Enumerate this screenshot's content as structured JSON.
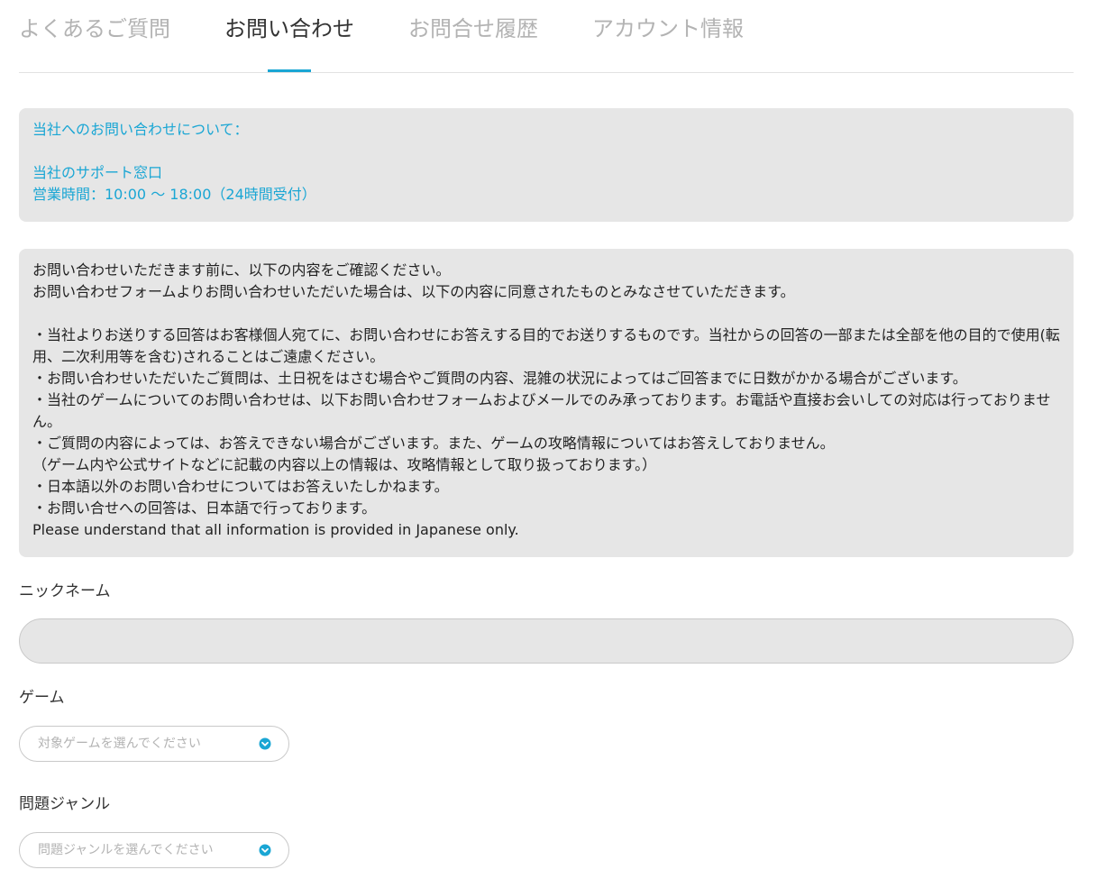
{
  "tabs": [
    {
      "label": "よくあるご質問",
      "active": false
    },
    {
      "label": "お問い合わせ",
      "active": true
    },
    {
      "label": "お問合せ履歴",
      "active": false
    },
    {
      "label": "アカウント情報",
      "active": false
    }
  ],
  "notice": {
    "lines": [
      "当社へのお問い合わせについて：",
      "",
      "当社のサポート窓口",
      "営業時間：10:00 〜 18:00（24時間受付）"
    ]
  },
  "terms": {
    "lines": [
      "お問い合わせいただきます前に、以下の内容をご確認ください。",
      "お問い合わせフォームよりお問い合わせいただいた場合は、以下の内容に同意されたものとみなさせていただきます。",
      "",
      "・当社よりお送りする回答はお客様個人宛てに、お問い合わせにお答えする目的でお送りするものです。当社からの回答の一部または全部を他の目的で使用(転",
      "用、二次利用等を含む)されることはご遠慮ください。",
      "・お問い合わせいただいたご質問は、土日祝をはさむ場合やご質問の内容、混雑の状況によってはご回答までに日数がかかる場合がございます。",
      "・当社のゲームについてのお問い合わせは、以下お問い合わせフォームおよびメールでのみ承っております。お電話や直接お会いしての対応は行っておりませ",
      "ん。",
      "・ご質問の内容によっては、お答えできない場合がございます。また、ゲームの攻略情報についてはお答えしておりません。",
      "（ゲーム内や公式サイトなどに記載の内容以上の情報は、攻略情報として取り扱っております。）",
      "・日本語以外のお問い合わせについてはお答えいたしかねます。",
      "・お問い合せへの回答は、日本語で行っております。",
      "Please understand that all information is provided in Japanese only."
    ]
  },
  "form": {
    "nickname": {
      "label": "ニックネーム",
      "value": "",
      "placeholder": ""
    },
    "game": {
      "label": "ゲーム",
      "placeholder": "対象ゲームを選んでください"
    },
    "genre": {
      "label": "問題ジャンル",
      "placeholder": "問題ジャンルを選んでください"
    }
  },
  "colors": {
    "accent": "#1aa6d4",
    "box_bg": "#e6e6e6",
    "inactive_tab": "#b3b3b3"
  },
  "icons": {
    "select_chevron": "chevron-down-circle-icon"
  }
}
